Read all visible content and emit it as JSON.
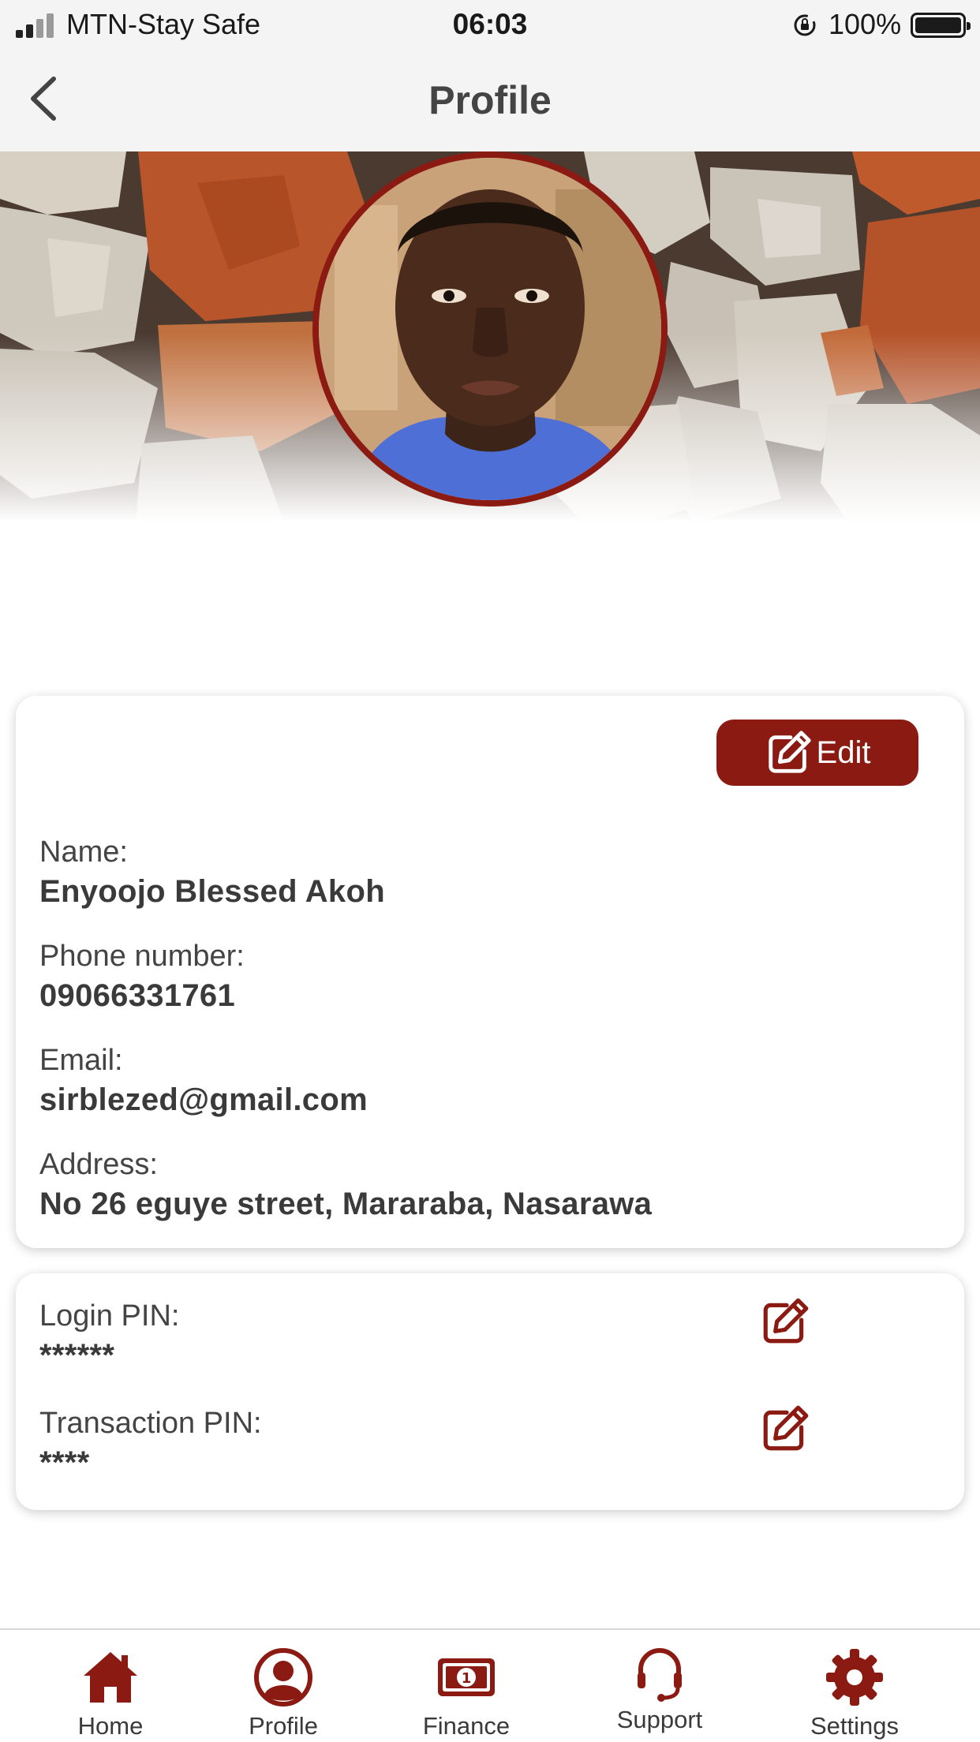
{
  "status_bar": {
    "carrier": "MTN-Stay Safe",
    "time": "06:03",
    "battery": "100%"
  },
  "nav": {
    "title": "Profile"
  },
  "profile": {
    "edit_label": "Edit",
    "name_label": "Name:",
    "name": "Enyoojo Blessed Akoh",
    "phone_label": "Phone number:",
    "phone": "09066331761",
    "email_label": "Email:",
    "email": "sirblezed@gmail.com",
    "address_label": "Address:",
    "address": "No 26 eguye street, Mararaba, Nasarawa"
  },
  "security": {
    "login_pin_label": "Login PIN:",
    "login_pin": "******",
    "transaction_pin_label": "Transaction PIN:",
    "transaction_pin": "****"
  },
  "tabs": [
    {
      "label": "Home",
      "icon": "home-icon"
    },
    {
      "label": "Profile",
      "icon": "profile-icon"
    },
    {
      "label": "Finance",
      "icon": "banknote-icon"
    },
    {
      "label": "Support",
      "icon": "headset-icon"
    },
    {
      "label": "Settings",
      "icon": "gear-icon"
    }
  ],
  "colors": {
    "accent": "#8b1a12",
    "text": "#3c3c3c",
    "bar_background": "#f4f4f4"
  }
}
